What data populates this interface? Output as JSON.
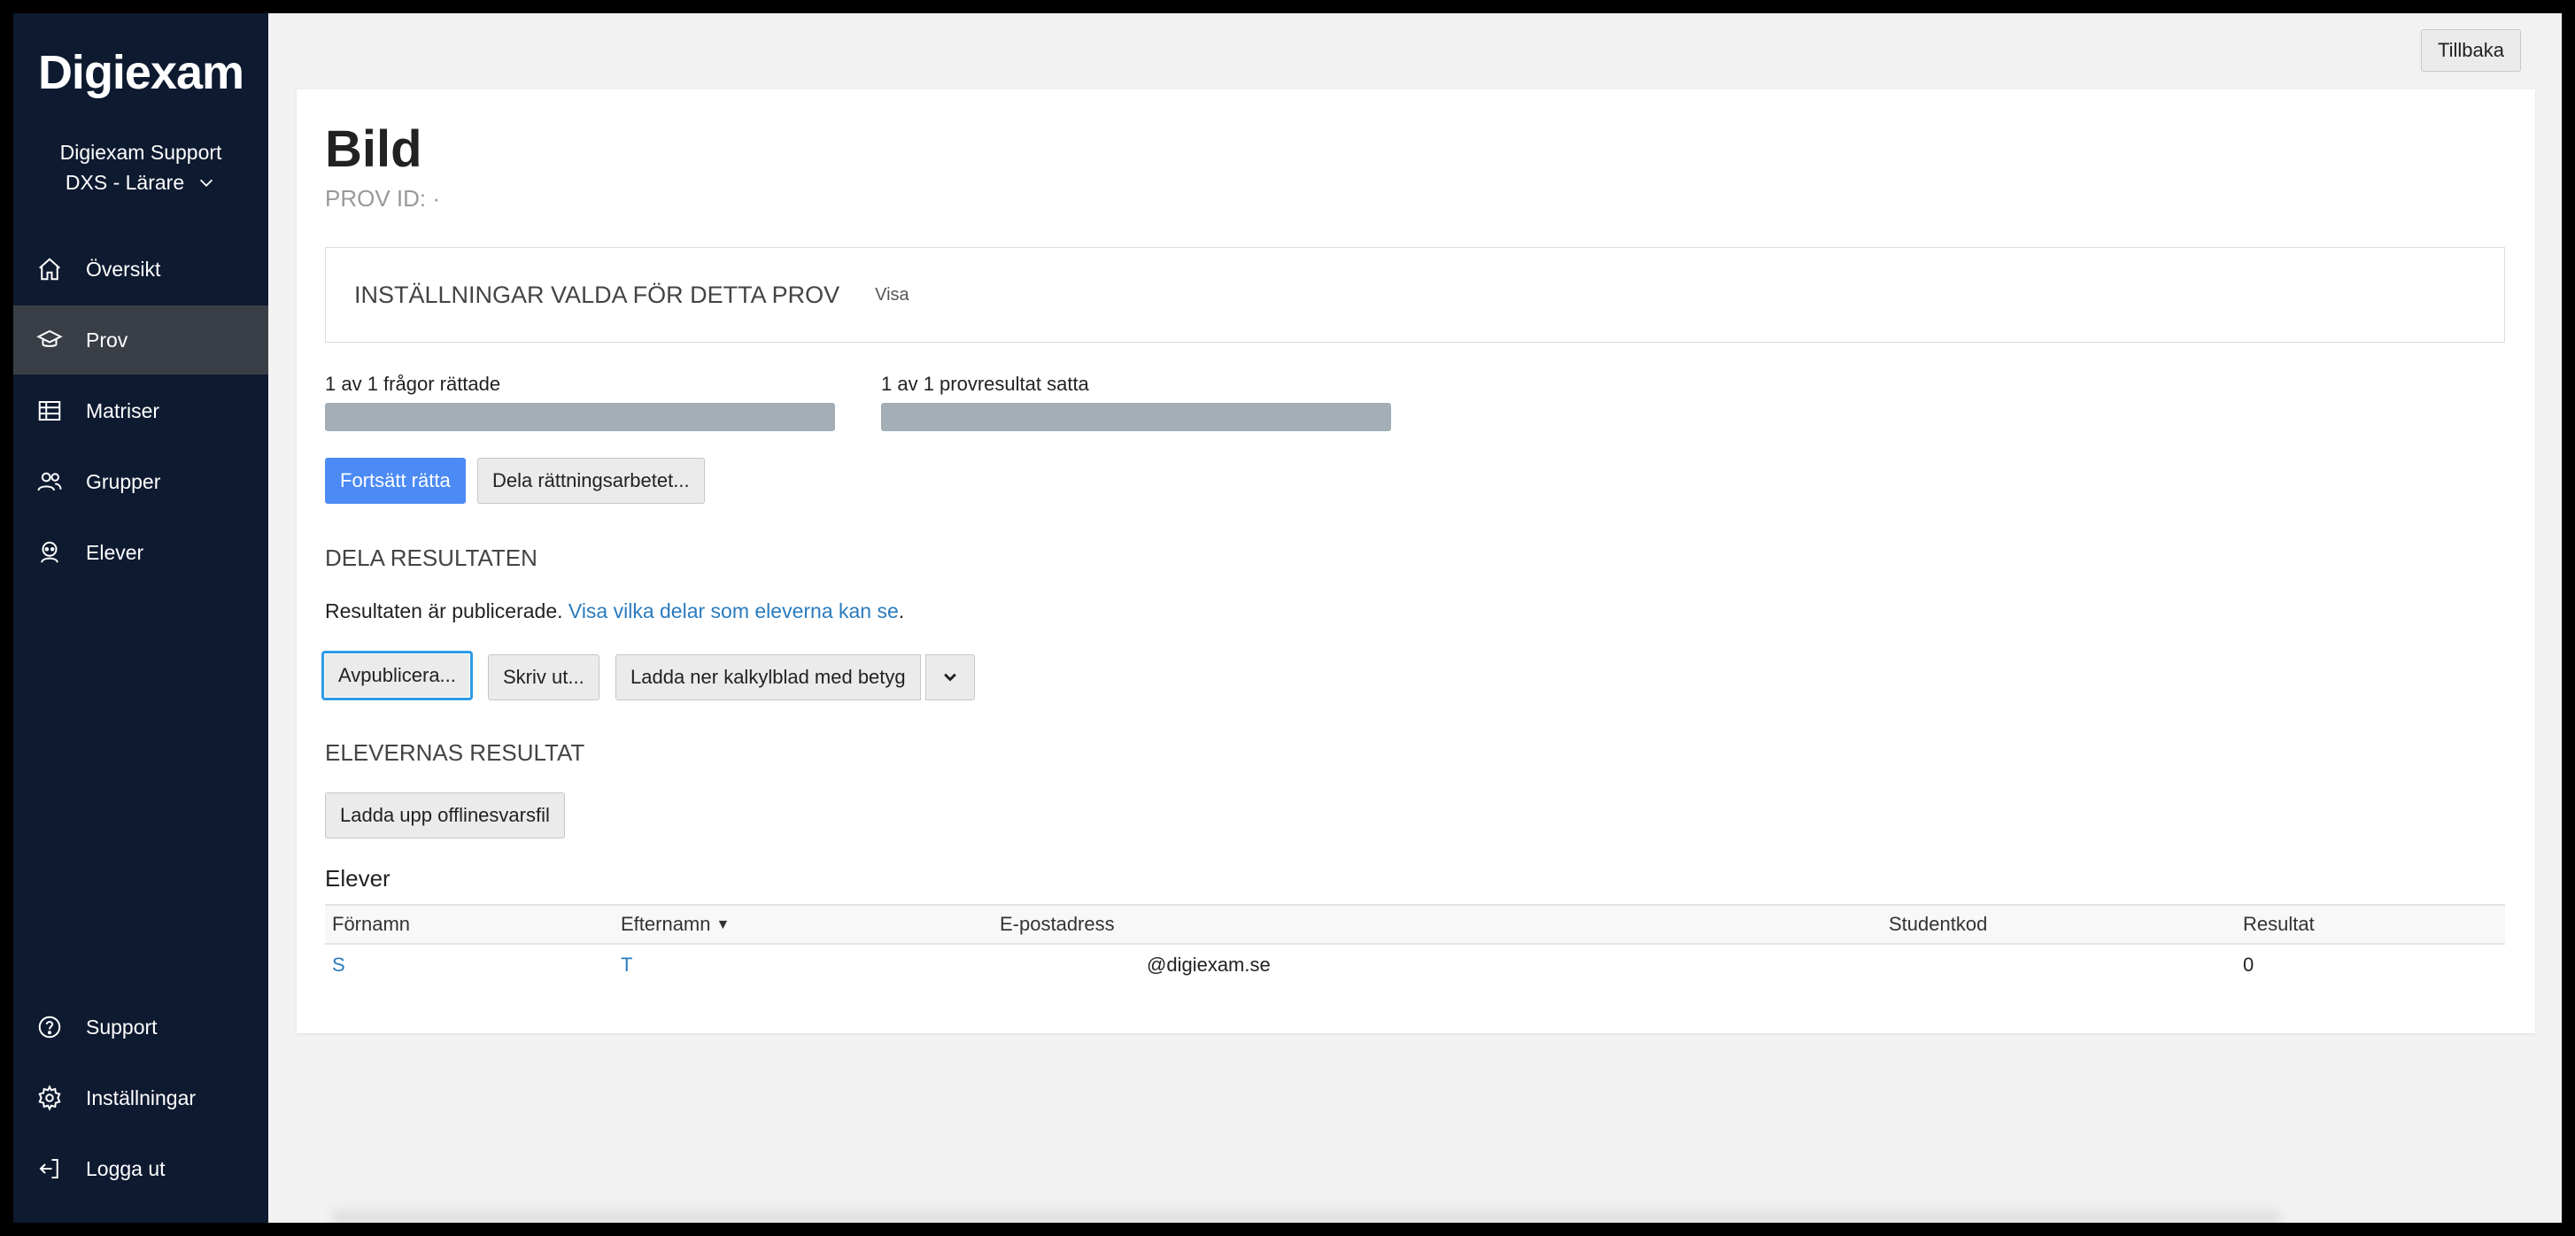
{
  "sidebar": {
    "logo": "Digiexam",
    "account_name": "Digiexam Support",
    "account_role": "DXS - Lärare",
    "nav": [
      {
        "label": "Översikt",
        "icon": "home-icon"
      },
      {
        "label": "Prov",
        "icon": "graduation-cap-icon",
        "active": true
      },
      {
        "label": "Matriser",
        "icon": "table-icon"
      },
      {
        "label": "Grupper",
        "icon": "users-icon"
      },
      {
        "label": "Elever",
        "icon": "student-icon"
      }
    ],
    "bottom_nav": [
      {
        "label": "Support",
        "icon": "help-icon"
      },
      {
        "label": "Inställningar",
        "icon": "gear-icon"
      },
      {
        "label": "Logga ut",
        "icon": "logout-icon"
      }
    ]
  },
  "header": {
    "back_label": "Tillbaka"
  },
  "exam": {
    "title": "Bild",
    "prov_id_label": "PROV ID: ·"
  },
  "settings": {
    "title": "INSTÄLLNINGAR VALDA FÖR DETTA PROV",
    "show_label": "Visa"
  },
  "progress": {
    "questions_label": "1 av 1 frågor rättade",
    "questions_fraction": 1.0,
    "results_label": "1 av 1 provresultat satta",
    "results_fraction": 1.0
  },
  "actions": {
    "continue_label": "Fortsätt rätta",
    "share_label": "Dela rättningsarbetet..."
  },
  "share": {
    "title": "DELA RESULTATEN",
    "published_text": "Resultaten är publicerade.",
    "published_link": "Visa vilka delar som eleverna kan se",
    "published_end": ".",
    "unpublish_label": "Avpublicera...",
    "print_label": "Skriv ut...",
    "download_label": "Ladda ner kalkylblad med betyg"
  },
  "results": {
    "title": "ELEVERNAS RESULTAT",
    "upload_label": "Ladda upp offlinesvarsfil"
  },
  "students": {
    "title": "Elever",
    "columns": [
      "Förnamn",
      "Efternamn",
      "E-postadress",
      "Studentkod",
      "Resultat"
    ],
    "rows": [
      {
        "first": "S",
        "last": "T",
        "email": "@digiexam.se",
        "code": "",
        "result": "0"
      }
    ]
  },
  "colors": {
    "sidebar_bg": "#0e1a30",
    "primary": "#4c8bf5",
    "link": "#2a7bbd",
    "progress_fill": "#a3aeb6"
  }
}
